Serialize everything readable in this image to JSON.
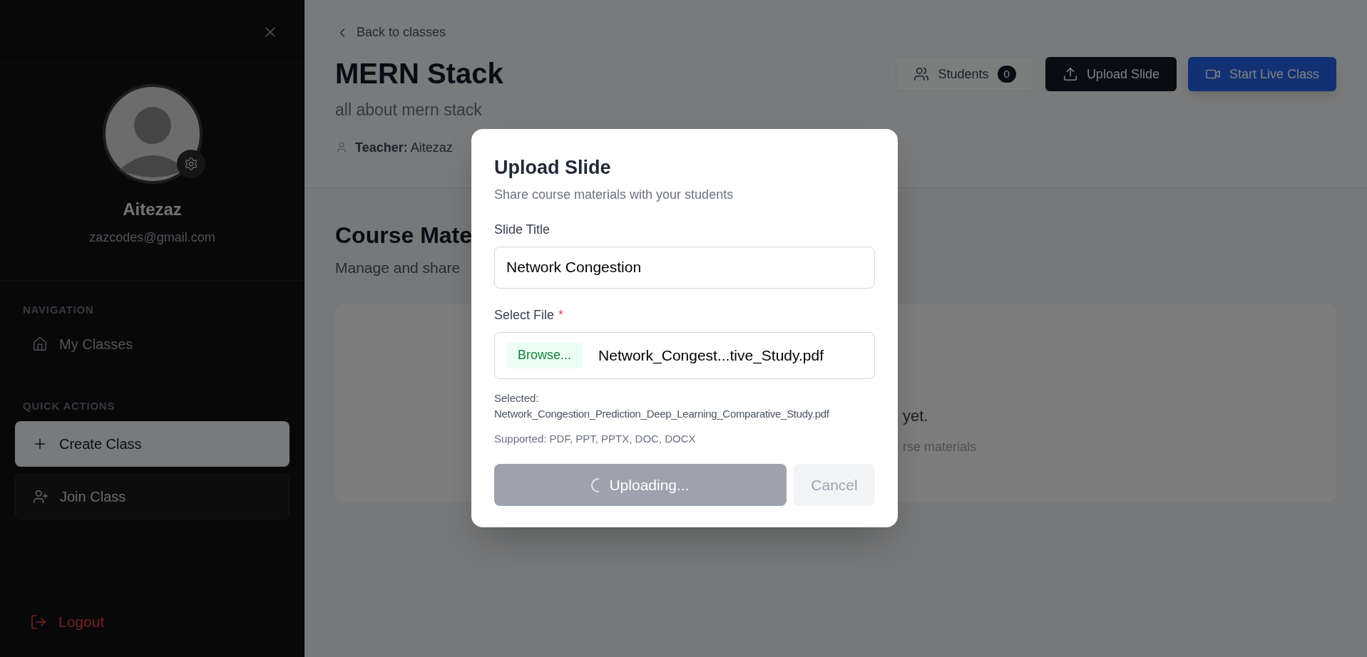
{
  "sidebar": {
    "profile": {
      "name": "Aitezaz",
      "email": "zazcodes@gmail.com"
    },
    "sections": [
      {
        "heading": "NAVIGATION",
        "items": [
          {
            "label": "My Classes",
            "kind": "link"
          }
        ]
      },
      {
        "heading": "QUICK ACTIONS",
        "items": [
          {
            "label": "Create Class",
            "kind": "primary"
          },
          {
            "label": "Join Class",
            "kind": "secondary"
          }
        ]
      }
    ],
    "logout": "Logout"
  },
  "header": {
    "back_link": "Back to classes",
    "title": "MERN Stack",
    "description": "all about mern stack",
    "teacher": {
      "label": "Teacher:",
      "value": "Aitezaz"
    },
    "buttons": [
      {
        "label": "Students",
        "kind": "outline",
        "badge": "0"
      },
      {
        "label": "Upload Slide",
        "kind": "dark"
      },
      {
        "label": "Start Live Class",
        "kind": "primary"
      }
    ]
  },
  "materials": {
    "heading": "Course Mate",
    "subtitle": "Manage and share",
    "empty_state": {
      "message": "yet.",
      "hint": "rse materials"
    }
  },
  "modal": {
    "title": "Upload Slide",
    "subtitle": "Share course materials with your students",
    "slide_title": {
      "label": "Slide Title",
      "value": "Network Congestion"
    },
    "file": {
      "label": "Select File",
      "required_mark": "*",
      "browse": "Browse...",
      "file_name": "Network_Congest...tive_Study.pdf",
      "selected_label": "Selected:",
      "selected_value": "Network_Congestion_Prediction_Deep_Learning_Comparative_Study.pdf",
      "supported": "Supported: PDF, PPT, PPTX, DOC, DOCX"
    },
    "submit": {
      "label": "Uploading...",
      "loading": true
    },
    "cancel": {
      "label": "Cancel",
      "disabled": true
    }
  }
}
